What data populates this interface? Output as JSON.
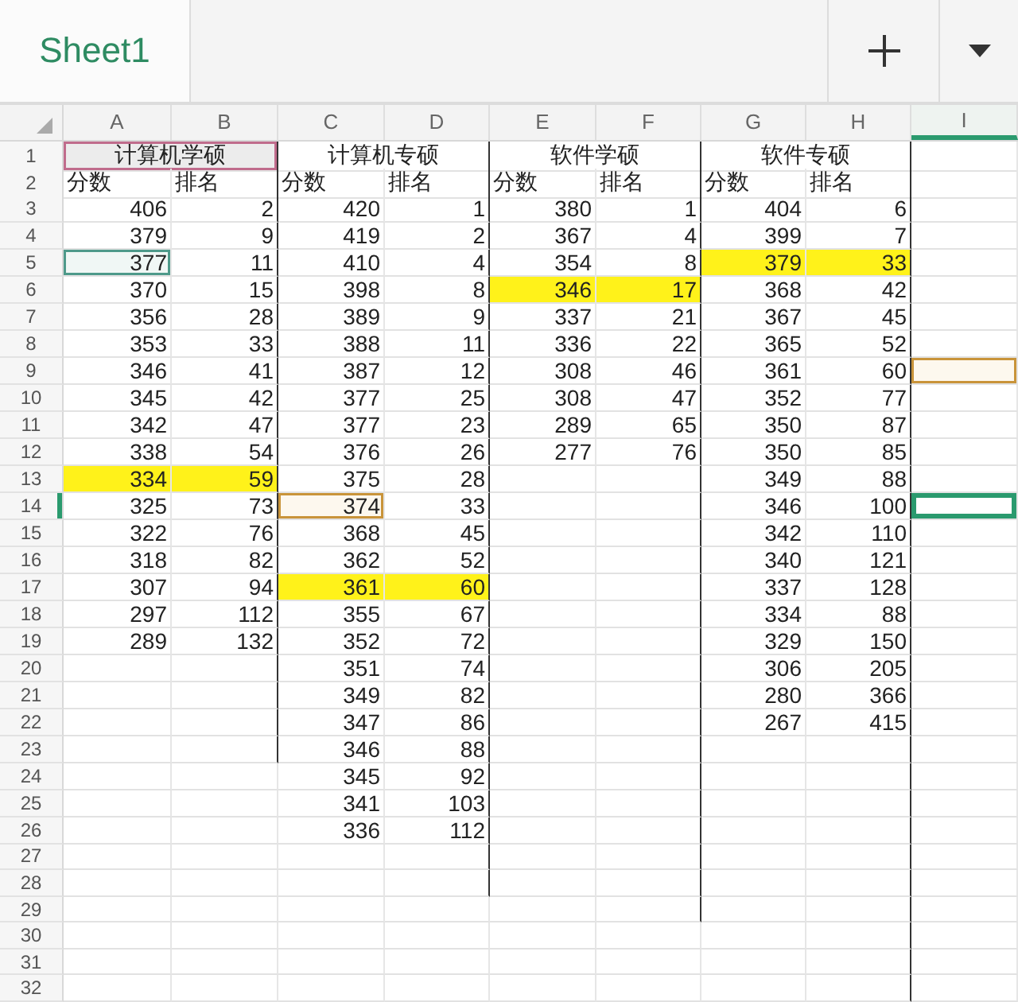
{
  "tabs": [
    {
      "label": "Sheet1",
      "selected": true
    }
  ],
  "columns": [
    {
      "label": "A",
      "selected": false
    },
    {
      "label": "B",
      "selected": false
    },
    {
      "label": "C",
      "selected": false
    },
    {
      "label": "D",
      "selected": false
    },
    {
      "label": "E",
      "selected": false
    },
    {
      "label": "F",
      "selected": false
    },
    {
      "label": "G",
      "selected": false
    },
    {
      "label": "H",
      "selected": false
    },
    {
      "label": "I",
      "selected": true
    }
  ],
  "rows": [
    {
      "label": "1",
      "selected": false,
      "active": false,
      "marked": false
    },
    {
      "label": "2",
      "selected": false,
      "active": false,
      "marked": false
    },
    {
      "label": "3",
      "selected": false,
      "active": false,
      "marked": false
    },
    {
      "label": "4",
      "selected": false,
      "active": false,
      "marked": false
    },
    {
      "label": "5",
      "selected": false,
      "active": false,
      "marked": false
    },
    {
      "label": "6",
      "selected": false,
      "active": false,
      "marked": false
    },
    {
      "label": "7",
      "selected": false,
      "active": false,
      "marked": false
    },
    {
      "label": "8",
      "selected": false,
      "active": false,
      "marked": false
    },
    {
      "label": "9",
      "selected": false,
      "active": false,
      "marked": true
    },
    {
      "label": "10",
      "selected": false,
      "active": false,
      "marked": false
    },
    {
      "label": "11",
      "selected": false,
      "active": false,
      "marked": false
    },
    {
      "label": "12",
      "selected": false,
      "active": false,
      "marked": false
    },
    {
      "label": "13",
      "selected": false,
      "active": false,
      "marked": false
    },
    {
      "label": "14",
      "selected": true,
      "active": true,
      "marked": false
    },
    {
      "label": "15",
      "selected": false,
      "active": false,
      "marked": false
    },
    {
      "label": "16",
      "selected": false,
      "active": false,
      "marked": false
    },
    {
      "label": "17",
      "selected": false,
      "active": false,
      "marked": false
    },
    {
      "label": "18",
      "selected": false,
      "active": false,
      "marked": false
    },
    {
      "label": "19",
      "selected": false,
      "active": false,
      "marked": false
    },
    {
      "label": "20",
      "selected": false,
      "active": false,
      "marked": false
    },
    {
      "label": "21",
      "selected": false,
      "active": false,
      "marked": false
    },
    {
      "label": "22",
      "selected": false,
      "active": false,
      "marked": false
    },
    {
      "label": "23",
      "selected": false,
      "active": false,
      "marked": false
    },
    {
      "label": "24",
      "selected": false,
      "active": false,
      "marked": false
    },
    {
      "label": "25",
      "selected": false,
      "active": false,
      "marked": false
    },
    {
      "label": "26",
      "selected": false,
      "active": false,
      "marked": false
    },
    {
      "label": "27",
      "selected": false,
      "active": false,
      "marked": false
    },
    {
      "label": "28",
      "selected": false,
      "active": false,
      "marked": false
    },
    {
      "label": "29",
      "selected": false,
      "active": false,
      "marked": false
    },
    {
      "label": "30",
      "selected": false,
      "active": false,
      "marked": false
    },
    {
      "label": "31",
      "selected": false,
      "active": false,
      "marked": false
    },
    {
      "label": "32",
      "selected": false,
      "active": false,
      "marked": false
    }
  ],
  "sections": [
    {
      "title": "计算机学硕",
      "selected": true,
      "headers": [
        "分数",
        "排名"
      ],
      "entries": [
        {
          "score": "406",
          "rank": "2",
          "highlighted": false,
          "cursor": false,
          "marked": false
        },
        {
          "score": "379",
          "rank": "9",
          "highlighted": false,
          "cursor": false,
          "marked": false
        },
        {
          "score": "377",
          "rank": "11",
          "highlighted": false,
          "cursor": true,
          "marked": false
        },
        {
          "score": "370",
          "rank": "15",
          "highlighted": false,
          "cursor": false,
          "marked": false
        },
        {
          "score": "356",
          "rank": "28",
          "highlighted": false,
          "cursor": false,
          "marked": false
        },
        {
          "score": "353",
          "rank": "33",
          "highlighted": false,
          "cursor": false,
          "marked": false
        },
        {
          "score": "346",
          "rank": "41",
          "highlighted": false,
          "cursor": false,
          "marked": false
        },
        {
          "score": "345",
          "rank": "42",
          "highlighted": false,
          "cursor": false,
          "marked": false
        },
        {
          "score": "342",
          "rank": "47",
          "highlighted": false,
          "cursor": false,
          "marked": false
        },
        {
          "score": "338",
          "rank": "54",
          "highlighted": false,
          "cursor": false,
          "marked": false
        },
        {
          "score": "334",
          "rank": "59",
          "highlighted": true,
          "cursor": false,
          "marked": false
        },
        {
          "score": "325",
          "rank": "73",
          "highlighted": false,
          "cursor": false,
          "marked": false
        },
        {
          "score": "322",
          "rank": "76",
          "highlighted": false,
          "cursor": false,
          "marked": false
        },
        {
          "score": "318",
          "rank": "82",
          "highlighted": false,
          "cursor": false,
          "marked": false
        },
        {
          "score": "307",
          "rank": "94",
          "highlighted": false,
          "cursor": false,
          "marked": false
        },
        {
          "score": "297",
          "rank": "112",
          "highlighted": false,
          "cursor": false,
          "marked": false
        },
        {
          "score": "289",
          "rank": "132",
          "highlighted": false,
          "cursor": false,
          "marked": false
        }
      ]
    },
    {
      "title": "计算机专硕",
      "selected": false,
      "headers": [
        "分数",
        "排名"
      ],
      "entries": [
        {
          "score": "420",
          "rank": "1",
          "highlighted": false,
          "cursor": false,
          "marked": false
        },
        {
          "score": "419",
          "rank": "2",
          "highlighted": false,
          "cursor": false,
          "marked": false
        },
        {
          "score": "410",
          "rank": "4",
          "highlighted": false,
          "cursor": false,
          "marked": false
        },
        {
          "score": "398",
          "rank": "8",
          "highlighted": false,
          "cursor": false,
          "marked": false
        },
        {
          "score": "389",
          "rank": "9",
          "highlighted": false,
          "cursor": false,
          "marked": false
        },
        {
          "score": "388",
          "rank": "11",
          "highlighted": false,
          "cursor": false,
          "marked": false
        },
        {
          "score": "387",
          "rank": "12",
          "highlighted": false,
          "cursor": false,
          "marked": false
        },
        {
          "score": "377",
          "rank": "25",
          "highlighted": false,
          "cursor": false,
          "marked": false
        },
        {
          "score": "377",
          "rank": "23",
          "highlighted": false,
          "cursor": false,
          "marked": false
        },
        {
          "score": "376",
          "rank": "26",
          "highlighted": false,
          "cursor": false,
          "marked": false
        },
        {
          "score": "375",
          "rank": "28",
          "highlighted": false,
          "cursor": false,
          "marked": false
        },
        {
          "score": "374",
          "rank": "33",
          "highlighted": false,
          "cursor": false,
          "marked": true
        },
        {
          "score": "368",
          "rank": "45",
          "highlighted": false,
          "cursor": false,
          "marked": false
        },
        {
          "score": "362",
          "rank": "52",
          "highlighted": false,
          "cursor": false,
          "marked": false
        },
        {
          "score": "361",
          "rank": "60",
          "highlighted": true,
          "cursor": false,
          "marked": false
        },
        {
          "score": "355",
          "rank": "67",
          "highlighted": false,
          "cursor": false,
          "marked": false
        },
        {
          "score": "352",
          "rank": "72",
          "highlighted": false,
          "cursor": false,
          "marked": false
        },
        {
          "score": "351",
          "rank": "74",
          "highlighted": false,
          "cursor": false,
          "marked": false
        },
        {
          "score": "349",
          "rank": "82",
          "highlighted": false,
          "cursor": false,
          "marked": false
        },
        {
          "score": "347",
          "rank": "86",
          "highlighted": false,
          "cursor": false,
          "marked": false
        },
        {
          "score": "346",
          "rank": "88",
          "highlighted": false,
          "cursor": false,
          "marked": false
        },
        {
          "score": "345",
          "rank": "92",
          "highlighted": false,
          "cursor": false,
          "marked": false
        },
        {
          "score": "341",
          "rank": "103",
          "highlighted": false,
          "cursor": false,
          "marked": false
        },
        {
          "score": "336",
          "rank": "112",
          "highlighted": false,
          "cursor": false,
          "marked": false
        }
      ]
    },
    {
      "title": "软件学硕",
      "selected": false,
      "headers": [
        "分数",
        "排名"
      ],
      "entries": [
        {
          "score": "380",
          "rank": "1",
          "highlighted": false,
          "cursor": false,
          "marked": false
        },
        {
          "score": "367",
          "rank": "4",
          "highlighted": false,
          "cursor": false,
          "marked": false
        },
        {
          "score": "354",
          "rank": "8",
          "highlighted": false,
          "cursor": false,
          "marked": false
        },
        {
          "score": "346",
          "rank": "17",
          "highlighted": true,
          "cursor": false,
          "marked": false
        },
        {
          "score": "337",
          "rank": "21",
          "highlighted": false,
          "cursor": false,
          "marked": false
        },
        {
          "score": "336",
          "rank": "22",
          "highlighted": false,
          "cursor": false,
          "marked": false
        },
        {
          "score": "308",
          "rank": "46",
          "highlighted": false,
          "cursor": false,
          "marked": false
        },
        {
          "score": "308",
          "rank": "47",
          "highlighted": false,
          "cursor": false,
          "marked": false
        },
        {
          "score": "289",
          "rank": "65",
          "highlighted": false,
          "cursor": false,
          "marked": false
        },
        {
          "score": "277",
          "rank": "76",
          "highlighted": false,
          "cursor": false,
          "marked": false
        }
      ]
    },
    {
      "title": "软件专硕",
      "selected": false,
      "headers": [
        "分数",
        "排名"
      ],
      "entries": [
        {
          "score": "404",
          "rank": "6",
          "highlighted": false,
          "cursor": false,
          "marked": false
        },
        {
          "score": "399",
          "rank": "7",
          "highlighted": false,
          "cursor": false,
          "marked": false
        },
        {
          "score": "379",
          "rank": "33",
          "highlighted": true,
          "cursor": false,
          "marked": false
        },
        {
          "score": "368",
          "rank": "42",
          "highlighted": false,
          "cursor": false,
          "marked": false
        },
        {
          "score": "367",
          "rank": "45",
          "highlighted": false,
          "cursor": false,
          "marked": false
        },
        {
          "score": "365",
          "rank": "52",
          "highlighted": false,
          "cursor": false,
          "marked": false
        },
        {
          "score": "361",
          "rank": "60",
          "highlighted": false,
          "cursor": false,
          "marked": false
        },
        {
          "score": "352",
          "rank": "77",
          "highlighted": false,
          "cursor": false,
          "marked": false
        },
        {
          "score": "350",
          "rank": "87",
          "highlighted": false,
          "cursor": false,
          "marked": false
        },
        {
          "score": "350",
          "rank": "85",
          "highlighted": false,
          "cursor": false,
          "marked": false
        },
        {
          "score": "349",
          "rank": "88",
          "highlighted": false,
          "cursor": false,
          "marked": false
        },
        {
          "score": "346",
          "rank": "100",
          "highlighted": false,
          "cursor": false,
          "marked": false
        },
        {
          "score": "342",
          "rank": "110",
          "highlighted": false,
          "cursor": false,
          "marked": false
        },
        {
          "score": "340",
          "rank": "121",
          "highlighted": false,
          "cursor": false,
          "marked": false
        },
        {
          "score": "337",
          "rank": "128",
          "highlighted": false,
          "cursor": false,
          "marked": false
        },
        {
          "score": "334",
          "rank": "88",
          "highlighted": false,
          "cursor": false,
          "marked": false
        },
        {
          "score": "329",
          "rank": "150",
          "highlighted": false,
          "cursor": false,
          "marked": false
        },
        {
          "score": "306",
          "rank": "205",
          "highlighted": false,
          "cursor": false,
          "marked": false
        },
        {
          "score": "280",
          "rank": "366",
          "highlighted": false,
          "cursor": false,
          "marked": false
        },
        {
          "score": "267",
          "rank": "415",
          "highlighted": false,
          "cursor": false,
          "marked": false
        }
      ]
    }
  ]
}
